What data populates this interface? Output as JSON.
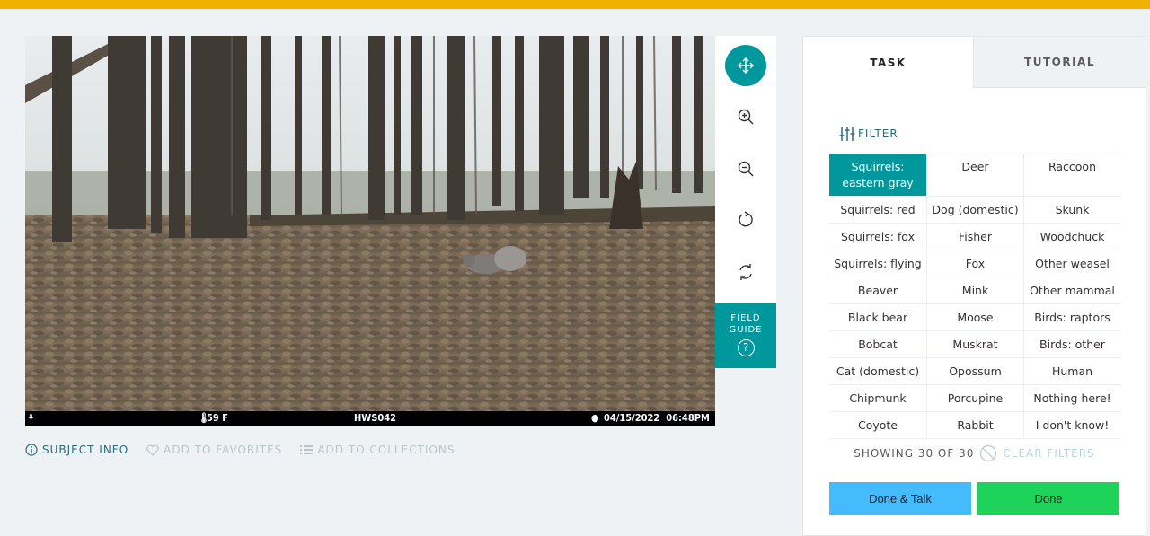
{
  "colors": {
    "accent": "#00979d",
    "topbar": "#f0b200",
    "done_talk": "#43bbfd",
    "done": "#1ed359"
  },
  "camera": {
    "temperature": "59 F",
    "camera_id": "HWS042",
    "timestamp": "04/15/2022  06:48PM"
  },
  "toolbar": {
    "tools": [
      "move-icon",
      "zoom-in-icon",
      "zoom-out-icon",
      "rotate-icon",
      "reset-icon"
    ],
    "field_guide": "FIELD GUIDE",
    "field_guide_icon": "?"
  },
  "meta": {
    "subject_info": "SUBJECT INFO",
    "favorites": "ADD TO FAVORITES",
    "collections": "ADD TO COLLECTIONS"
  },
  "tabs": {
    "task": "TASK",
    "tutorial": "TUTORIAL"
  },
  "filter": {
    "label": "FILTER"
  },
  "species": [
    [
      "Squirrels: eastern gray",
      "Deer",
      "Raccoon"
    ],
    [
      "Squirrels: red",
      "Dog (domestic)",
      "Skunk"
    ],
    [
      "Squirrels: fox",
      "Fisher",
      "Woodchuck"
    ],
    [
      "Squirrels: flying",
      "Fox",
      "Other weasel"
    ],
    [
      "Beaver",
      "Mink",
      "Other mammal"
    ],
    [
      "Black bear",
      "Moose",
      "Birds: raptors"
    ],
    [
      "Bobcat",
      "Muskrat",
      "Birds: other"
    ],
    [
      "Cat (domestic)",
      "Opossum",
      "Human"
    ],
    [
      "Chipmunk",
      "Porcupine",
      "Nothing here!"
    ],
    [
      "Coyote",
      "Rabbit",
      "I don't know!"
    ]
  ],
  "selected_species": "Squirrels: eastern gray",
  "status": {
    "showing": "SHOWING 30 OF 30",
    "clear_filters": "CLEAR FILTERS"
  },
  "buttons": {
    "done_talk": "Done & Talk",
    "done": "Done"
  }
}
